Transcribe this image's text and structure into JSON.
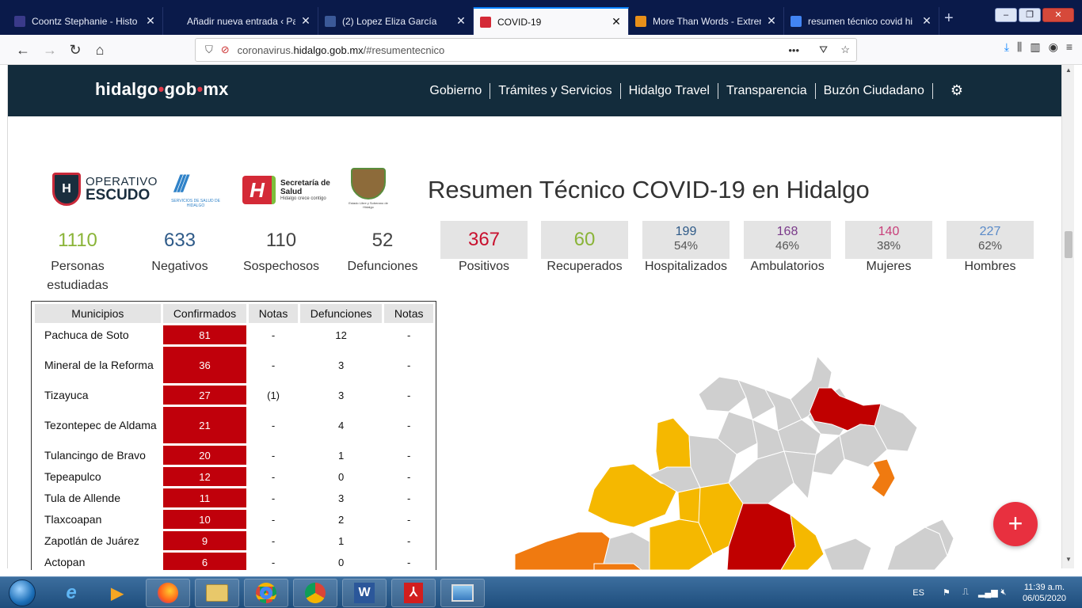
{
  "browser": {
    "tabs": [
      {
        "title": "Coontz Stephanie - Histo",
        "fav_color": "#3a3a8a",
        "active": false
      },
      {
        "title": "Añadir nueva entrada ‹ Paradi",
        "fav_color": "#0a1a4a",
        "active": false
      },
      {
        "title": "(2) Lopez Eliza García",
        "fav_color": "#3b5998",
        "active": false
      },
      {
        "title": "COVID-19",
        "fav_color": "#d42a37",
        "active": true
      },
      {
        "title": "More Than Words - Extren",
        "fav_color": "#e8901a",
        "active": false
      },
      {
        "title": "resumen técnico covid hi",
        "fav_color": "#4285f4",
        "active": false
      }
    ],
    "url_domain_prefix": "coronavirus.",
    "url_domain": "hidalgo.gob.mx",
    "url_path": "/#resumentecnico",
    "menu_dots": "•••"
  },
  "site": {
    "brand_a": "hidalgo",
    "brand_b": "gob",
    "brand_c": "mx",
    "menu": [
      "Gobierno",
      "Trámites y Servicios",
      "Hidalgo Travel",
      "Transparencia",
      "Buzón Ciudadano"
    ]
  },
  "logos": {
    "escudo_a": "OPERATIVO",
    "escudo_b": "ESCUDO",
    "ssh_cap": "SERVICIOS DE SALUD DE HIDALGO",
    "salud_a": "Secretaría de",
    "salud_b": "Salud",
    "salud_c": "Hidalgo crece contigo",
    "estado_cap": "Estado Libre y Soberano de Hidalgo"
  },
  "page_title": "Resumen Técnico COVID-19 en Hidalgo",
  "stats": {
    "estudiadas": {
      "value": "1110",
      "label1": "Personas",
      "label2": "estudiadas",
      "color": "#8ab438"
    },
    "negativos": {
      "value": "633",
      "label": "Negativos",
      "color": "#2e5a88"
    },
    "sospechosos": {
      "value": "110",
      "label": "Sospechosos",
      "color": "#444444"
    },
    "defunciones": {
      "value": "52",
      "label": "Defunciones",
      "color": "#444444"
    },
    "positivos": {
      "value": "367",
      "label": "Positivos",
      "color": "#c8102e"
    },
    "recuperados": {
      "value": "60",
      "label": "Recuperados",
      "color": "#8ab438"
    },
    "hospitalizados": {
      "value": "199",
      "pct": "54%",
      "label": "Hospitalizados",
      "color": "#2e5a88"
    },
    "ambulatorios": {
      "value": "168",
      "pct": "46%",
      "label": "Ambulatorios",
      "color": "#7a3a8a"
    },
    "mujeres": {
      "value": "140",
      "pct": "38%",
      "label": "Mujeres",
      "color": "#c8407a"
    },
    "hombres": {
      "value": "227",
      "pct": "62%",
      "label": "Hombres",
      "color": "#5a8ac8"
    }
  },
  "table": {
    "headers": [
      "Municipios",
      "Confirmados",
      "Notas",
      "Defunciones",
      "Notas"
    ],
    "rows": [
      {
        "mun": "Pachuca de Soto",
        "conf": "81",
        "n1": "-",
        "def": "12",
        "n2": "-"
      },
      {
        "mun": "Mineral de la Reforma",
        "conf": "36",
        "n1": "-",
        "def": "3",
        "n2": "-"
      },
      {
        "mun": "Tizayuca",
        "conf": "27",
        "n1": "(1)",
        "def": "3",
        "n2": "-"
      },
      {
        "mun": "Tezontepec de Aldama",
        "conf": "21",
        "n1": "-",
        "def": "4",
        "n2": "-"
      },
      {
        "mun": "Tulancingo de Bravo",
        "conf": "20",
        "n1": "-",
        "def": "1",
        "n2": "-"
      },
      {
        "mun": "Tepeapulco",
        "conf": "12",
        "n1": "-",
        "def": "0",
        "n2": "-"
      },
      {
        "mun": "Tula de Allende",
        "conf": "11",
        "n1": "-",
        "def": "3",
        "n2": "-"
      },
      {
        "mun": "Tlaxcoapan",
        "conf": "10",
        "n1": "-",
        "def": "2",
        "n2": "-"
      },
      {
        "mun": "Zapotlán de Juárez",
        "conf": "9",
        "n1": "-",
        "def": "1",
        "n2": "-"
      },
      {
        "mun": "Actopan",
        "conf": "6",
        "n1": "-",
        "def": "0",
        "n2": "-"
      }
    ]
  },
  "map_colors": {
    "none": "#cfcfcf",
    "low": "#f5b800",
    "mid": "#f07a10",
    "high": "#c00000"
  },
  "fab": "+",
  "taskbar": {
    "lang": "ES",
    "time": "11:39 a.m.",
    "date": "06/05/2020",
    "word_letter": "W"
  }
}
